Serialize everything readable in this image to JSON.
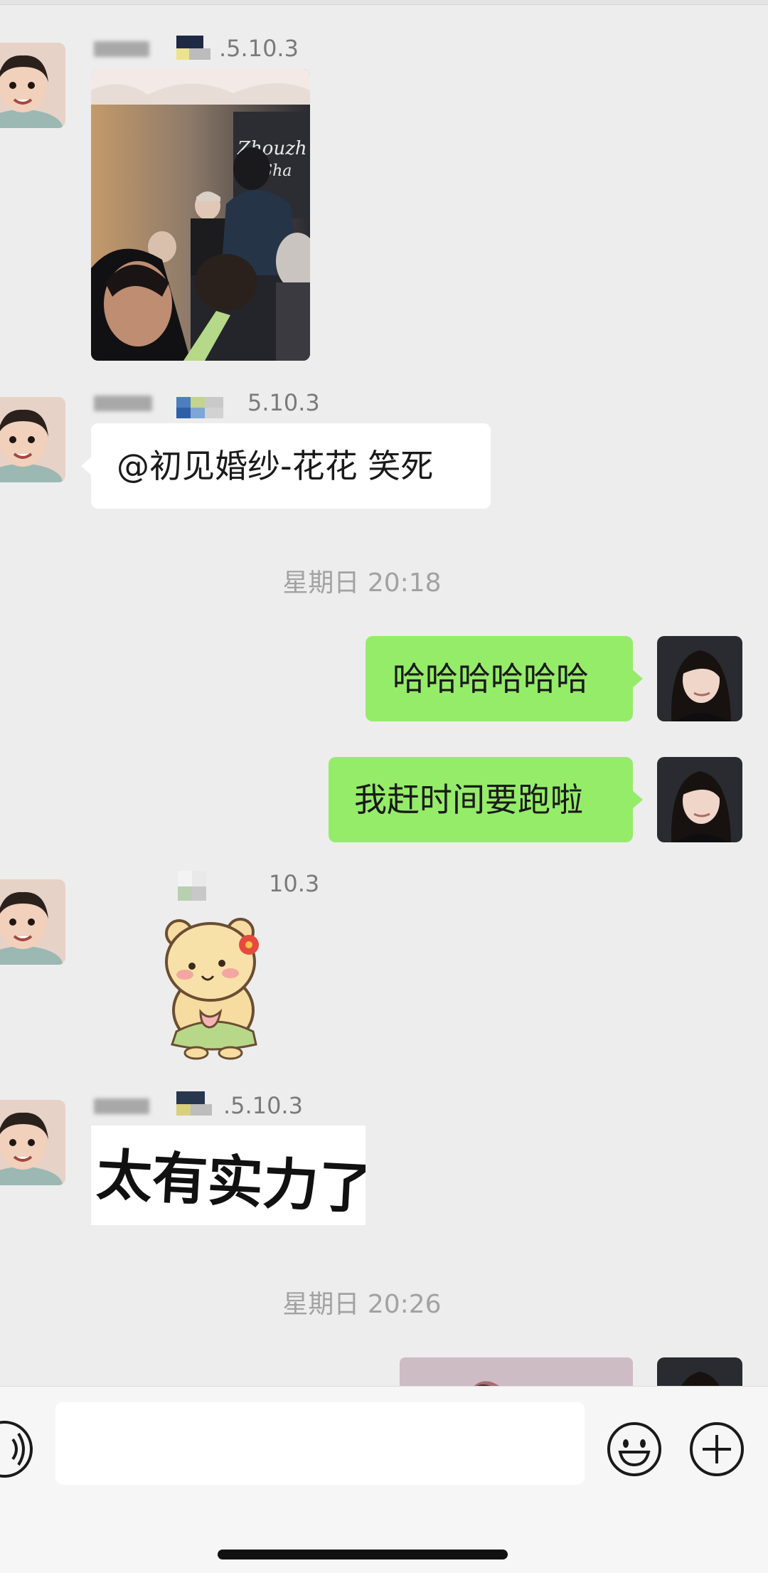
{
  "messages": {
    "group1": {
      "sender_suffix": ".5.10.3"
    },
    "group2": {
      "sender_suffix": "5.10.3",
      "text": "@初见婚纱-花花 笑死"
    },
    "time1": "星期日 20:18",
    "out1": "哈哈哈哈哈哈",
    "out2": "我赶时间要跑啦",
    "group3": {
      "sender_suffix": "10.3"
    },
    "group4": {
      "sender_suffix": ".5.10.3",
      "sticker_text": "太有实力了"
    },
    "time2": "星期日 20:26"
  },
  "colors": {
    "background": "#ededed",
    "incoming_bubble": "#ffffff",
    "outgoing_bubble": "#95ec69",
    "timestamp": "#a2a2a2"
  },
  "input_bar": {
    "value": "",
    "icons": [
      "voice-icon",
      "emoji-icon",
      "plus-icon"
    ]
  }
}
